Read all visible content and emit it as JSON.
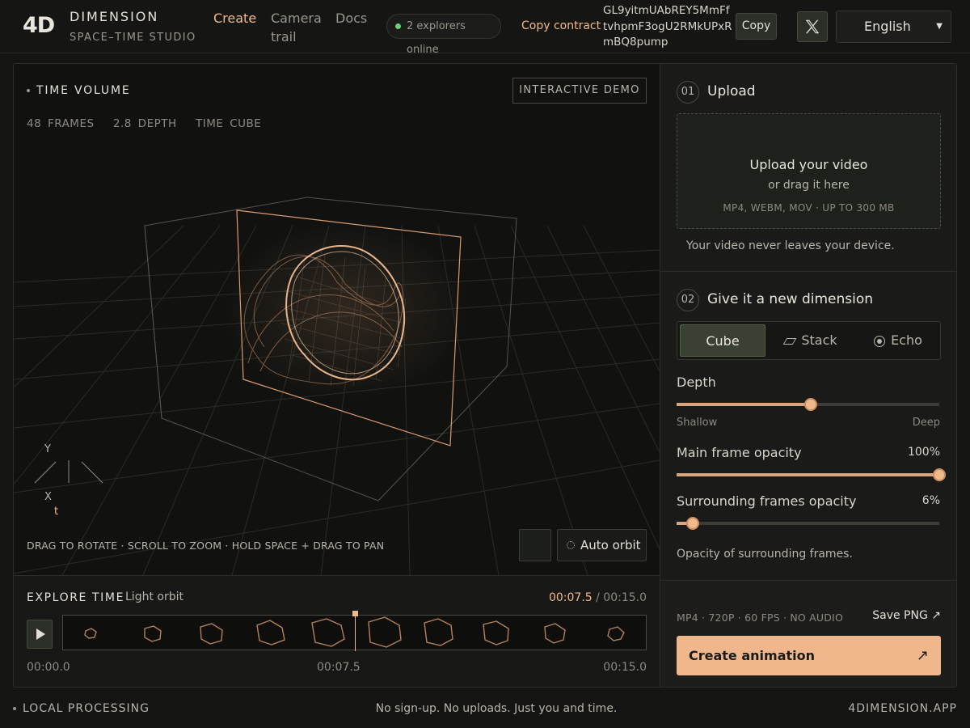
{
  "header": {
    "logo": "4D",
    "brand_name": "DIMENSION",
    "brand_sub": "SPACE–TIME STUDIO",
    "nav": {
      "create": "Create",
      "camera_trail": "Camera trail",
      "docs": "Docs"
    },
    "online": "2 explorers online",
    "copy_contract_label": "Copy contract",
    "contract": "GL9yitmUAbREY5MmFftvhpmF3ogU2RMkUPxRmBQ8pump",
    "copy_button": "Copy",
    "x_icon": "x-logo-icon",
    "language": "English"
  },
  "viewport": {
    "title": "TIME VOLUME",
    "demo_badge": "INTERACTIVE DEMO",
    "stats": "48 FRAMES   2.8 DEPTH   TIME CUBE",
    "axis_y": "Y",
    "axis_x": "X",
    "axis_t": "t",
    "help": "DRAG TO ROTATE · SCROLL TO ZOOM · HOLD SPACE + DRAG TO PAN",
    "auto_orbit": "Auto orbit"
  },
  "timeline": {
    "title": "EXPLORE TIME",
    "mode": "Light orbit",
    "current": "00:07.5",
    "total": "/ 00:15.0",
    "start": "00:00.0",
    "mid": "00:07.5",
    "end": "00:15.0",
    "playhead_fraction": 0.5
  },
  "sidebar": {
    "upload": {
      "num": "01",
      "title": "Upload",
      "drop_title": "Upload your video",
      "drop_sub": "or drag it here",
      "drop_formats": "MP4, WEBM, MOV · UP TO 300 MB",
      "privacy": "Your video never leaves your device."
    },
    "dimension": {
      "num": "02",
      "title": "Give it a new dimension",
      "modes": [
        "Cube",
        "Stack",
        "Echo"
      ],
      "selected_mode": "Cube",
      "depth_label": "Depth",
      "depth_min": "Shallow",
      "depth_max": "Deep",
      "depth_value": 0.51,
      "main_opacity_label": "Main frame opacity",
      "main_opacity_value": "100%",
      "main_opacity_fraction": 1.0,
      "surround_opacity_label": "Surrounding frames opacity",
      "surround_opacity_value": "6%",
      "surround_opacity_fraction": 0.06,
      "note": "Opacity of surrounding frames."
    },
    "export": {
      "format": "MP4 · 720P · 60 FPS · NO AUDIO",
      "save_png": "Save PNG ↗",
      "create": "Create animation",
      "create_arrow": "↗"
    }
  },
  "footer": {
    "left": "LOCAL PROCESSING",
    "mid": "No sign-up. No uploads. Just you and time.",
    "right": "4DIMENSION.APP"
  },
  "colors": {
    "accent": "#f0b98a",
    "background": "#141513",
    "panel": "#1a1b18",
    "online": "#6fcf7a"
  }
}
